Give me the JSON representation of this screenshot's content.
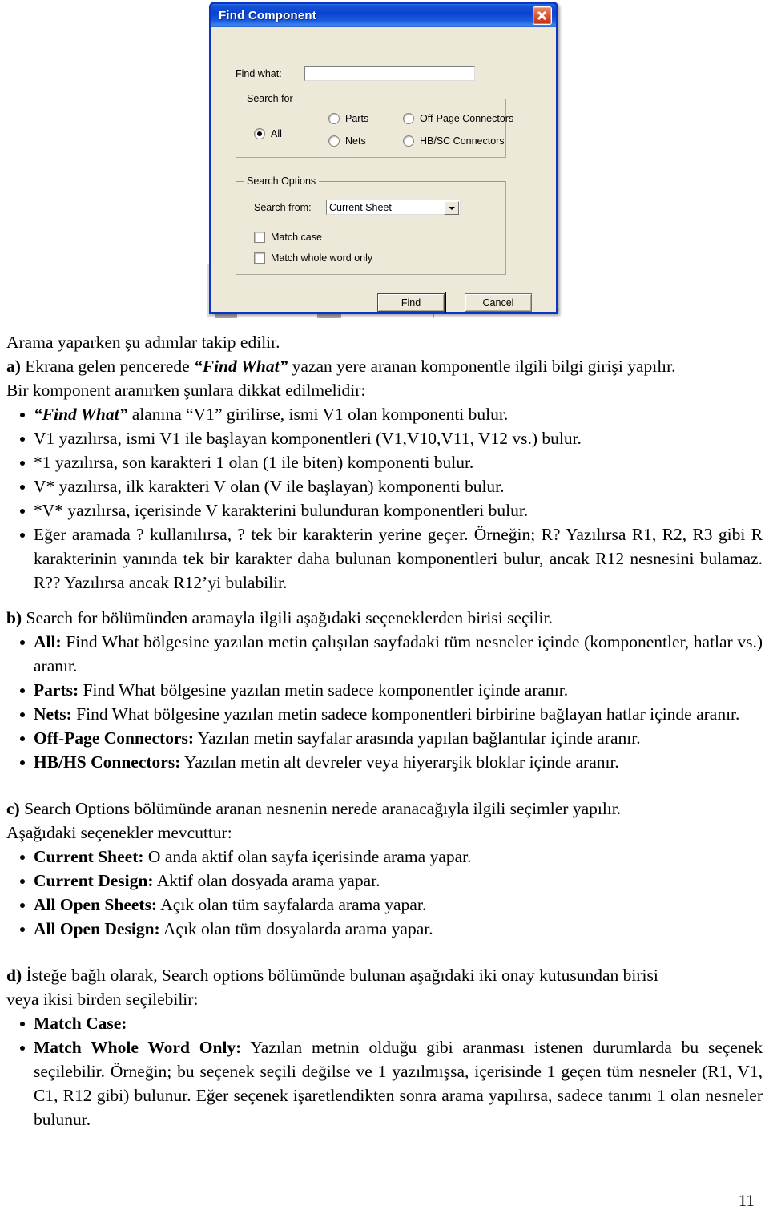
{
  "dialog": {
    "title": "Find Component",
    "close_icon": "close-icon",
    "find_what": {
      "label": "Find what:",
      "value": "",
      "placeholder": ""
    },
    "search_for": {
      "legend": "Search for",
      "options": [
        {
          "label": "All",
          "checked": true
        },
        {
          "label": "Parts",
          "checked": false
        },
        {
          "label": "Nets",
          "checked": false
        },
        {
          "label": "Off-Page Connectors",
          "checked": false
        },
        {
          "label": "HB/SC Connectors",
          "checked": false
        }
      ]
    },
    "search_options": {
      "legend": "Search Options",
      "search_from_label": "Search from:",
      "search_from_value": "Current Sheet",
      "dropdown_icon": "chevron-down-icon",
      "checkboxes": [
        {
          "label": "Match case",
          "checked": false
        },
        {
          "label": "Match whole word only",
          "checked": false
        }
      ]
    },
    "buttons": {
      "find": "Find",
      "cancel": "Cancel"
    },
    "colors": {
      "titlebar_blue": "#0a43d0",
      "dialog_face": "#ece9d8",
      "border_blue": "#0a36c8",
      "close_red": "#c22f12"
    }
  },
  "document": {
    "lead": "Arama yaparken şu adımlar takip edilir.",
    "section_a": {
      "marker": "a)",
      "text_1": " Ekrana gelen pencerede ",
      "quote_1": "“Find What”",
      "text_2": " yazan yere aranan komponentle ilgili bilgi girişi yapılır.",
      "text_3": "Bir komponent aranırken şunlara dikkat edilmelidir:",
      "bullets": [
        {
          "quote": "“Find What”",
          "rest": " alanına “V1” girilirse, ismi V1 olan komponenti bulur."
        },
        {
          "quote": "",
          "rest": "V1 yazılırsa, ismi V1 ile başlayan komponentleri (V1,V10,V11, V12 vs.) bulur."
        },
        {
          "quote": "",
          "rest": "*1 yazılırsa, son karakteri 1 olan (1 ile biten) komponenti bulur."
        },
        {
          "quote": "",
          "rest": "V* yazılırsa, ilk karakteri V olan (V ile başlayan) komponenti bulur."
        },
        {
          "quote": "",
          "rest": "*V* yazılırsa, içerisinde V karakterini bulunduran komponentleri bulur."
        },
        {
          "quote": "",
          "rest": "Eğer aramada ? kullanılırsa, ? tek bir karakterin yerine geçer. Örneğin; R? Yazılırsa R1, R2, R3 gibi R karakterinin yanında tek bir karakter daha bulunan komponentleri bulur, ancak R12 nesnesini bulamaz. R?? Yazılırsa ancak R12’yi bulabilir."
        }
      ]
    },
    "section_b": {
      "marker": "b)",
      "intro": " Search for bölümünden aramayla ilgili aşağıdaki seçeneklerden birisi seçilir.",
      "bullets": [
        {
          "term": "All:",
          "desc": " Find What bölgesine yazılan metin çalışılan sayfadaki tüm nesneler içinde (komponentler, hatlar vs.) aranır."
        },
        {
          "term": "Parts:",
          "desc": " Find What bölgesine yazılan metin sadece komponentler içinde aranır."
        },
        {
          "term": "Nets:",
          "desc": " Find What bölgesine yazılan metin sadece komponentleri birbirine bağlayan hatlar içinde aranır."
        },
        {
          "term": "Off-Page Connectors:",
          "desc": " Yazılan metin sayfalar arasında yapılan bağlantılar içinde aranır."
        },
        {
          "term": "HB/HS Connectors:",
          "desc": " Yazılan metin alt devreler veya hiyerarşik bloklar içinde aranır."
        }
      ]
    },
    "section_c": {
      "marker": "c)",
      "intro": " Search Options bölümünde aranan nesnenin nerede aranacağıyla ilgili seçimler yapılır.",
      "intro_2": "Aşağıdaki seçenekler mevcuttur:",
      "bullets": [
        {
          "term": "Current Sheet:",
          "desc": " O anda aktif olan sayfa içerisinde arama yapar."
        },
        {
          "term": "Current Design:",
          "desc": " Aktif olan dosyada arama yapar."
        },
        {
          "term": "All Open Sheets:",
          "desc": " Açık olan tüm sayfalarda arama yapar."
        },
        {
          "term": "All Open Design:",
          "desc": " Açık olan tüm dosyalarda arama yapar."
        }
      ]
    },
    "section_d": {
      "marker": "d)",
      "intro": " İsteğe bağlı olarak, Search options bölümünde bulunan aşağıdaki iki onay kutusundan birisi",
      "intro_2": "veya ikisi birden seçilebilir:",
      "bullets": [
        {
          "term": "Match Case:",
          "desc": ""
        },
        {
          "term": "Match Whole Word Only:",
          "desc": " Yazılan metnin olduğu gibi aranması istenen durumlarda bu seçenek seçilebilir. Örneğin; bu seçenek seçili değilse ve 1 yazılmışsa, içerisinde 1 geçen tüm nesneler (R1, V1, C1, R12 gibi) bulunur. Eğer seçenek işaretlendikten sonra arama yapılırsa, sadece tanımı 1 olan nesneler bulunur."
        }
      ]
    },
    "page_number": "11"
  }
}
